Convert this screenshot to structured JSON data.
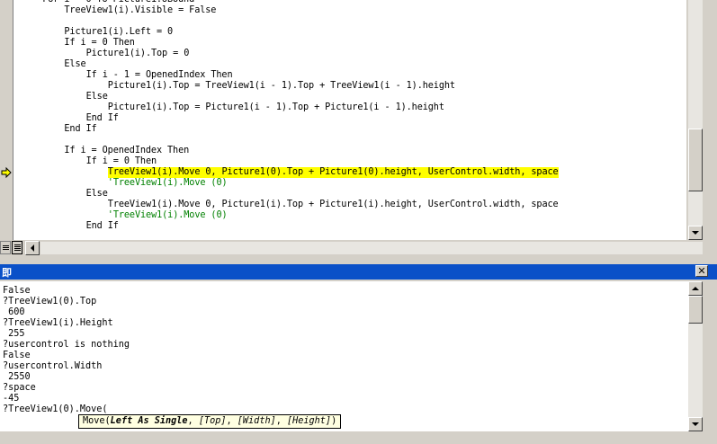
{
  "code": {
    "lines": [
      {
        "text": "For i = 0 To Picture1.UBound",
        "indent": 4
      },
      {
        "text": "TreeView1(i).Visible = False",
        "indent": 8
      },
      {
        "text": "",
        "indent": 0
      },
      {
        "text": "Picture1(i).Left = 0",
        "indent": 8
      },
      {
        "text": "If i = 0 Then",
        "indent": 8
      },
      {
        "text": "Picture1(i).Top = 0",
        "indent": 12
      },
      {
        "text": "Else",
        "indent": 8
      },
      {
        "text": "If i - 1 = OpenedIndex Then",
        "indent": 12
      },
      {
        "text": "Picture1(i).Top = TreeView1(i - 1).Top + TreeView1(i - 1).height",
        "indent": 16
      },
      {
        "text": "Else",
        "indent": 12
      },
      {
        "text": "Picture1(i).Top = Picture1(i - 1).Top + Picture1(i - 1).height",
        "indent": 16
      },
      {
        "text": "End If",
        "indent": 12
      },
      {
        "text": "End If",
        "indent": 8
      },
      {
        "text": "",
        "indent": 0
      },
      {
        "text": "If i = OpenedIndex Then",
        "indent": 8
      },
      {
        "text": "If i = 0 Then",
        "indent": 12
      },
      {
        "text": "TreeView1(i).Move 0, Picture1(0).Top + Picture1(0).height, UserControl.width, space",
        "indent": 16,
        "highlight": true
      },
      {
        "text": "'TreeView1(i).Move (0)",
        "indent": 16,
        "comment": true
      },
      {
        "text": "Else",
        "indent": 12
      },
      {
        "text": "TreeView1(i).Move 0, Picture1(i).Top + Picture1(i).height, UserControl.width, space",
        "indent": 16
      },
      {
        "text": "'TreeView1(i).Move (0)",
        "indent": 16,
        "comment": true
      },
      {
        "text": "End If",
        "indent": 12
      }
    ]
  },
  "immediate": {
    "title": "即",
    "close_label": "✕",
    "lines": [
      "False",
      "?TreeView1(0).Top",
      " 600",
      "?TreeView1(i).Height",
      " 255",
      "?usercontrol is nothing",
      "False",
      "?usercontrol.Width",
      " 2550",
      "?space",
      "-45",
      "?TreeView1(0).Move("
    ],
    "tooltip": {
      "method": "Move(",
      "param1": "Left As Single",
      "rest_a": ", ",
      "param2": "[Top]",
      "rest_b": ", ",
      "param3": "[Width]",
      "rest_c": ", ",
      "param4": "[Height]",
      "close": ")"
    }
  },
  "icons": {
    "exec_arrow": "current-statement-arrow-icon",
    "arrow_color": "#ffff00"
  },
  "colors": {
    "highlight": "#ffff00",
    "comment": "#008000",
    "title_bar": "#0a50c8",
    "tooltip_bg": "#ffffe1"
  }
}
